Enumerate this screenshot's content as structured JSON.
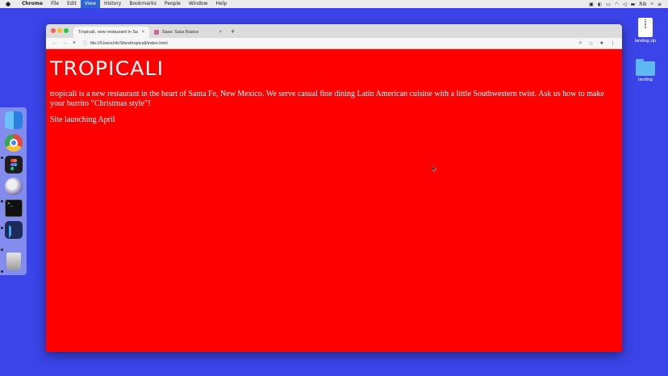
{
  "menubar": {
    "app_name": "Chrome",
    "items": [
      "File",
      "Edit",
      "View",
      "History",
      "Bookmarks",
      "People",
      "Window",
      "Help"
    ],
    "active_item": "View",
    "user": "Rik"
  },
  "desktop": {
    "items": [
      {
        "label": "landing.zip",
        "icon": "zip-file-icon"
      },
      {
        "label": "landing",
        "icon": "folder-icon"
      }
    ]
  },
  "dock": {
    "apps": [
      "finder-icon",
      "chrome-icon",
      "figma-icon",
      "movie-icon",
      "terminal-icon",
      "vscode-icon",
      "trash-icon"
    ]
  },
  "browser": {
    "tabs": [
      {
        "title": "Tropicali, new restaurant in Sa",
        "active": true
      },
      {
        "title": "Sass: Sass Basics",
        "active": false
      }
    ],
    "url": "file:///Users/rik/Sites/tropicali/index.html"
  },
  "page": {
    "logo": "TROPICALI",
    "description": "tropicali is a new restaurant in the heart of Santa Fe, New Mexico. We serve casual fine dining Latin American cuisine with a little Southwestern twist. Ask us how to make your burrito “Christmas style”!",
    "launch_text": "Site launching April",
    "background_color": "#ff0000"
  }
}
